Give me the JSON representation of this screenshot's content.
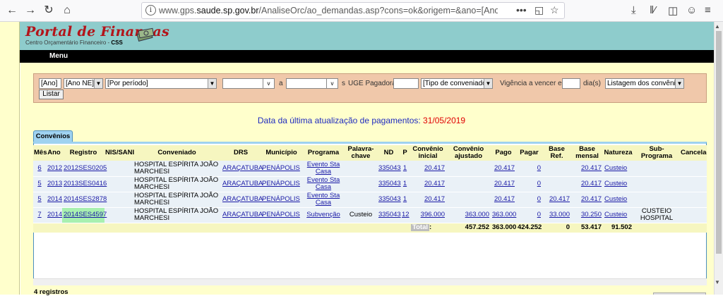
{
  "browser": {
    "url_host": "www.gps.saude.sp.gov.br",
    "url_path": "/AnaliseOrc/ao_demandas.asp?cons=ok&origem=&ano=[Ano]&ano_ne",
    "url_prefix": "www.gps.",
    "url_domain": "saude.sp.gov.br",
    "more_label": "•••"
  },
  "header": {
    "logo_title": "Portal de Finanças",
    "logo_subtitle": "Centro Orçamentário Financeiro",
    "logo_tag": "CSS",
    "menu_label": "Menu"
  },
  "filters": {
    "ano": "[Ano]",
    "ano_ne": "[Ano NE]",
    "periodo": "[Por período]",
    "date_from": "",
    "date_to": "",
    "between_label": "a",
    "s_label": "s",
    "ug_label": "UGE Pagadora:",
    "ug_value": "",
    "tipo_conveniado": "[Tipo de conveniado]",
    "vigencia_label": "Vigência a vencer em",
    "vigencia_value": "",
    "dias_label": "dia(s)",
    "listagem": "Listagem dos convênios",
    "listar_button": "Listar",
    "dd_v": "v"
  },
  "update": {
    "label": "Data da última atualização de pagamentos:",
    "date": "31/05/2019"
  },
  "tab_label": "Convênios",
  "table": {
    "headers": [
      "Mês",
      "Ano",
      "Registro",
      "NIS/SANI",
      "Conveniado",
      "DRS",
      "Município",
      "Programa",
      "Palavra-chave",
      "ND",
      "P",
      "Convênio inicial",
      "Convênio ajustado",
      "Pago",
      "Pagar",
      "Base Ref.",
      "Base mensal",
      "Natureza",
      "Sub-Programa",
      "Cancelado"
    ],
    "rows": [
      {
        "mes": "6",
        "ano": "2012",
        "registro": "2012SES0205",
        "nis": "",
        "conveniado": "HOSPITAL ESPÍRITA JOÃO MARCHESI",
        "drs": "ARAÇATUBA",
        "municipio": "PENÁPOLIS",
        "programa": "Evento Sta Casa",
        "palavra": "",
        "nd": "335043",
        "p": "1",
        "inicial": "20.417",
        "ajustado": "",
        "pago": "20.417",
        "pagar": "0",
        "base_ref": "",
        "base_mensal": "20.417",
        "natureza": "Custeio",
        "sub": "",
        "canc": ""
      },
      {
        "mes": "5",
        "ano": "2013",
        "registro": "2013SES0416",
        "nis": "",
        "conveniado": "HOSPITAL ESPÍRITA JOÃO MARCHESI",
        "drs": "ARAÇATUBA",
        "municipio": "PENÁPOLIS",
        "programa": "Evento Sta Casa",
        "palavra": "",
        "nd": "335043",
        "p": "1",
        "inicial": "20.417",
        "ajustado": "",
        "pago": "20.417",
        "pagar": "0",
        "base_ref": "",
        "base_mensal": "20.417",
        "natureza": "Custeio",
        "sub": "",
        "canc": ""
      },
      {
        "mes": "5",
        "ano": "2014",
        "registro": "2014SES2878",
        "nis": "",
        "conveniado": "HOSPITAL ESPÍRITA JOÃO MARCHESI",
        "drs": "ARAÇATUBA",
        "municipio": "PENÁPOLIS",
        "programa": "Evento Sta Casa",
        "palavra": "",
        "nd": "335043",
        "p": "1",
        "inicial": "20.417",
        "ajustado": "",
        "pago": "20.417",
        "pagar": "0",
        "base_ref": "20.417",
        "base_mensal": "20.417",
        "natureza": "Custeio",
        "sub": "",
        "canc": ""
      },
      {
        "mes": "7",
        "ano": "2014",
        "registro": "2014SES4597",
        "nis": "",
        "conveniado": "HOSPITAL ESPÍRITA JOÃO MARCHESI",
        "drs": "ARAÇATUBA",
        "municipio": "PENÁPOLIS",
        "programa": "Subvenção",
        "palavra": "Custeio",
        "nd": "335043",
        "p": "12",
        "inicial": "396.000",
        "ajustado": "363.000",
        "pago": "363.000",
        "pagar": "0",
        "base_ref": "33.000",
        "base_mensal": "30.250",
        "natureza": "Custeio",
        "sub": "CUSTEIO HOSPITAL",
        "canc": ""
      }
    ],
    "total": {
      "label": "Total",
      "suffix": ":",
      "inicial": "457.252",
      "pago": "363.000",
      "pagar": "424.252",
      "base_ref": "0",
      "base_mensal": "53.417",
      "natureza": "91.502"
    }
  },
  "record_count": "4 registros",
  "colors": {
    "header_bg": "#8ecccc",
    "logo_red": "#b3141a",
    "filter_bg": "#f0c8aa",
    "side_yellow": "#ffffcc",
    "link_blue": "#1a1aa6",
    "update_blue": "#1f2bbf",
    "date_red": "#e00000",
    "tab_blue": "#9fd2f0"
  },
  "icons": [
    "back-arrow-icon",
    "forward-arrow-icon",
    "reload-icon",
    "home-icon",
    "info-icon",
    "page-actions-icon",
    "pocket-icon",
    "bookmark-star-icon",
    "download-icon",
    "library-icon",
    "sidebar-icon",
    "account-icon",
    "hamburger-menu-icon",
    "money-stack-icon"
  ]
}
